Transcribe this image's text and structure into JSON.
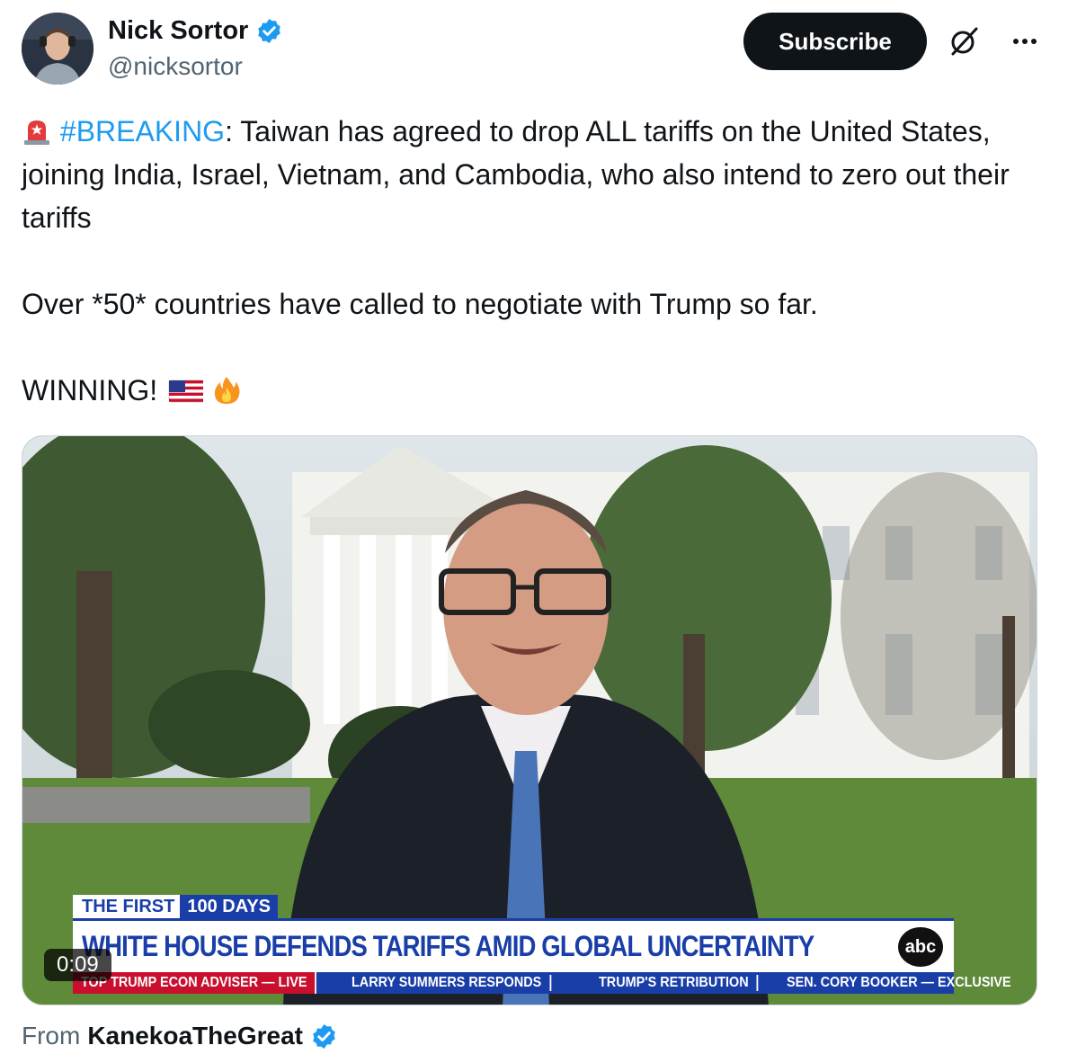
{
  "author": {
    "display_name": "Nick Sortor",
    "handle": "@nicksortor",
    "verified": true
  },
  "actions": {
    "subscribe_label": "Subscribe"
  },
  "tweet": {
    "line1_prefix_emoji": "siren",
    "hashtag": "#BREAKING",
    "line1_rest": ": Taiwan has agreed to drop ALL tariffs on the United States, joining India, Israel, Vietnam, and Cambodia, who also intend to zero out their tariffs",
    "paragraph2": "Over *50* countries have called to negotiate with Trump so far.",
    "paragraph3": "WINNING!",
    "paragraph3_emojis": [
      "us-flag",
      "fire"
    ]
  },
  "video": {
    "duration": "0:09",
    "chyron": {
      "tag_left": "THE FIRST",
      "tag_right": "100 DAYS",
      "headline": "WHITE HOUSE DEFENDS TARIFFS AMID GLOBAL UNCERTAINTY",
      "network": "abc",
      "ticker": [
        "TOP TRUMP ECON ADVISER — LIVE",
        "LARRY SUMMERS RESPONDS",
        "TRUMP'S RETRIBUTION",
        "SEN. CORY BOOKER — EXCLUSIVE"
      ]
    }
  },
  "attribution": {
    "prefix": "From",
    "source_name": "KanekoaTheGreat",
    "verified": true
  },
  "colors": {
    "hashtag": "#1d9bf0",
    "verified": "#1d9bf0",
    "subscribe_bg": "#0f1419",
    "chyron_blue": "#1a3ea8",
    "ticker_red": "#c8102e"
  }
}
